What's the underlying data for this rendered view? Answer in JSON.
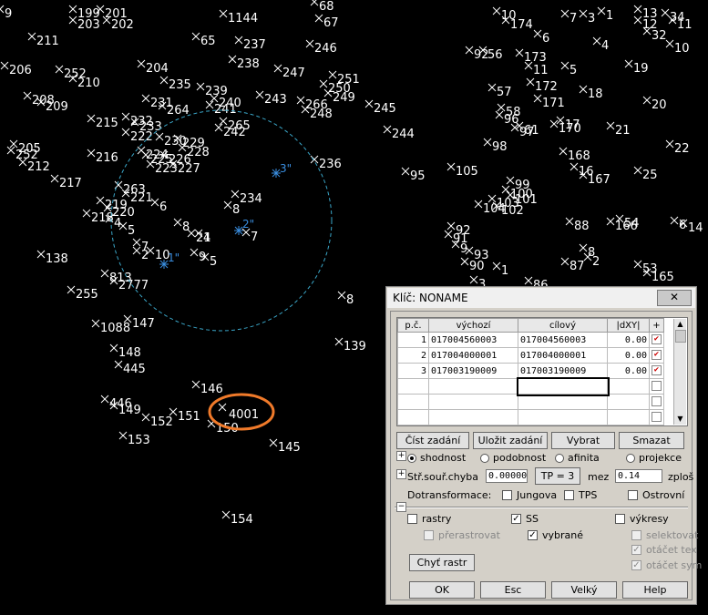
{
  "map": {
    "circle_labels": [
      "1\"",
      "2\"",
      "3\""
    ],
    "highlighted": "4001"
  },
  "dialog": {
    "title": "Klíč: NONAME",
    "close": "✕",
    "columns": [
      "p.č.",
      "výchozí",
      "cílový",
      "|dXY|",
      "+"
    ],
    "rows": [
      {
        "n": "1",
        "src": "017004560003",
        "dst": "017004560003",
        "dxy": "0.00"
      },
      {
        "n": "2",
        "src": "017004000001",
        "dst": "017004000001",
        "dxy": "0.00"
      },
      {
        "n": "3",
        "src": "017003190009",
        "dst": "017003190009",
        "dxy": "0.00"
      }
    ],
    "buttons": {
      "read": "Číst zadání",
      "save": "Uložit zadání",
      "select": "Vybrat",
      "delete": "Smazat"
    },
    "transform": {
      "shodnost": "shodnost",
      "podobnost": "podobnost",
      "afinita": "afinita",
      "projekce": "projekce"
    },
    "error": {
      "label": "Stř.souř.chyba",
      "value": "0.00000",
      "tp": "TP = 3",
      "mez": "mez",
      "mez_value": "0.14",
      "zplos": "zploš"
    },
    "dotrans": {
      "label": "Dotransformace:",
      "jungova": "Jungova",
      "tps": "TPS",
      "ostrovni": "Ostrovní"
    },
    "layers": {
      "rastry": "rastry",
      "ss": "SS",
      "vykresy": "výkresy",
      "prerastrovat": "přerastrovat",
      "vybrane": "vybrané",
      "selektovat": "selektovat",
      "otacet_text": "otáčet tex",
      "otacet_sym": "otáčet sym"
    },
    "chyt": "Chyť rastr",
    "footer": {
      "ok": "OK",
      "esc": "Esc",
      "velky": "Velký",
      "help": "Help"
    }
  }
}
